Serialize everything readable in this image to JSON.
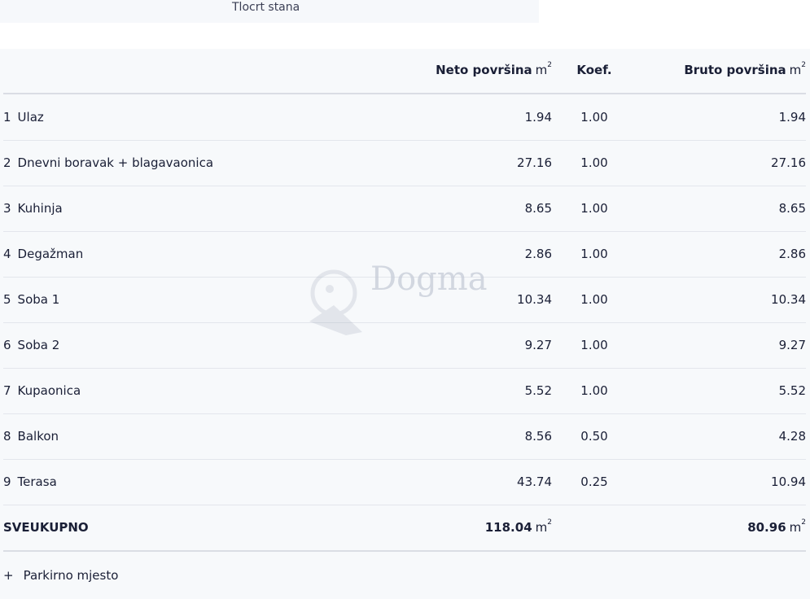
{
  "tab": {
    "label": "Tlocrt stana"
  },
  "table": {
    "headers": {
      "name": "",
      "neto": "Neto površina",
      "koef": "Koef.",
      "bruto": "Bruto površina",
      "unit": "m",
      "unit_sup": "2"
    },
    "rows": [
      {
        "num": "1",
        "name": "Ulaz",
        "neto": "1.94",
        "koef": "1.00",
        "bruto": "1.94"
      },
      {
        "num": "2",
        "name": "Dnevni boravak + blagavaonica",
        "neto": "27.16",
        "koef": "1.00",
        "bruto": "27.16"
      },
      {
        "num": "3",
        "name": "Kuhinja",
        "neto": "8.65",
        "koef": "1.00",
        "bruto": "8.65"
      },
      {
        "num": "4",
        "name": "Degažman",
        "neto": "2.86",
        "koef": "1.00",
        "bruto": "2.86"
      },
      {
        "num": "5",
        "name": "Soba 1",
        "neto": "10.34",
        "koef": "1.00",
        "bruto": "10.34"
      },
      {
        "num": "6",
        "name": "Soba 2",
        "neto": "9.27",
        "koef": "1.00",
        "bruto": "9.27"
      },
      {
        "num": "7",
        "name": "Kupaonica",
        "neto": "5.52",
        "koef": "1.00",
        "bruto": "5.52"
      },
      {
        "num": "8",
        "name": "Balkon",
        "neto": "8.56",
        "koef": "0.50",
        "bruto": "4.28"
      },
      {
        "num": "9",
        "name": "Terasa",
        "neto": "43.74",
        "koef": "0.25",
        "bruto": "10.94"
      }
    ],
    "total": {
      "label": "SVEUKUPNO",
      "neto": "118.04",
      "bruto": "80.96",
      "unit": "m",
      "unit_sup": "2"
    }
  },
  "extra": {
    "plus": "+",
    "label": "Parkirno mjesto"
  },
  "watermark": {
    "text": "Dogma"
  }
}
